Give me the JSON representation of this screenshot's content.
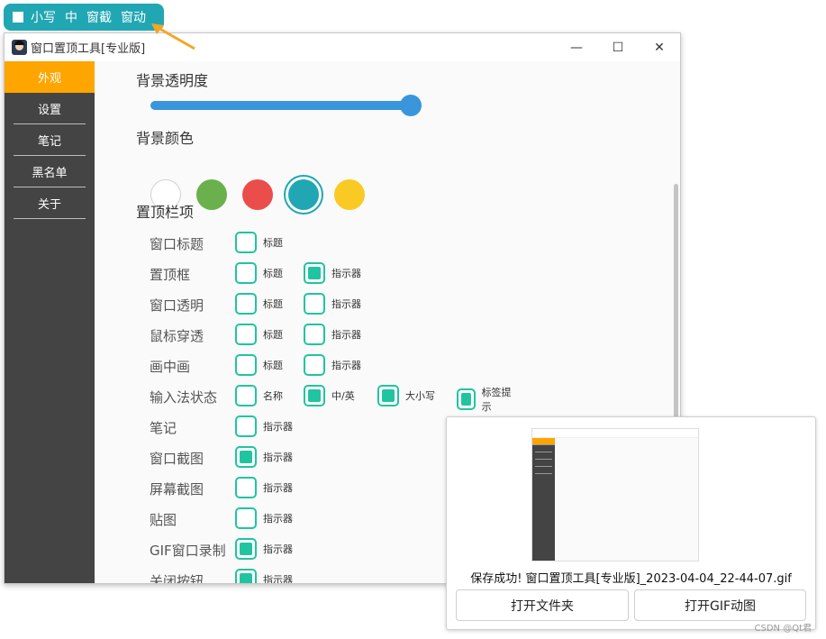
{
  "floatbar": {
    "items": [
      "小写",
      "中",
      "窗截",
      "窗动"
    ]
  },
  "window": {
    "title": "窗口置顶工具[专业版]",
    "controls": {
      "minimize": "—",
      "maximize": "☐",
      "close": "✕"
    }
  },
  "sidebar": {
    "items": [
      {
        "label": "外观"
      },
      {
        "label": "设置"
      },
      {
        "label": "笔记"
      },
      {
        "label": "黑名单"
      },
      {
        "label": "关于"
      }
    ]
  },
  "main": {
    "opacity_label": "背景透明度",
    "opacity_value": 1.0,
    "color_label": "背景颜色",
    "colors": [
      "#ffffff",
      "#6ab04c",
      "#eb4d4b",
      "#21a7b3",
      "#f9ca24"
    ],
    "selected_color": "#21a7b3",
    "topbar_label": "置顶栏项",
    "rows": [
      {
        "label": "窗口标题",
        "options": [
          {
            "text": "标题",
            "checked": false
          }
        ]
      },
      {
        "label": "置顶框",
        "options": [
          {
            "text": "标题",
            "checked": false
          },
          {
            "text": "指示器",
            "checked": true
          }
        ]
      },
      {
        "label": "窗口透明",
        "options": [
          {
            "text": "标题",
            "checked": false
          },
          {
            "text": "指示器",
            "checked": false
          }
        ]
      },
      {
        "label": "鼠标穿透",
        "options": [
          {
            "text": "标题",
            "checked": false
          },
          {
            "text": "指示器",
            "checked": false
          }
        ]
      },
      {
        "label": "画中画",
        "options": [
          {
            "text": "标题",
            "checked": false
          },
          {
            "text": "指示器",
            "checked": false
          }
        ]
      },
      {
        "label": "输入法状态",
        "options": [
          {
            "text": "名称",
            "checked": false
          },
          {
            "text": "中/英",
            "checked": true
          },
          {
            "text": "大小写",
            "checked": true
          },
          {
            "text": "标签提示",
            "checked": true
          }
        ]
      },
      {
        "label": "笔记",
        "options": [
          {
            "text": "指示器",
            "checked": false
          }
        ]
      },
      {
        "label": "窗口截图",
        "options": [
          {
            "text": "指示器",
            "checked": true
          }
        ]
      },
      {
        "label": "屏幕截图",
        "options": [
          {
            "text": "指示器",
            "checked": false
          }
        ]
      },
      {
        "label": "贴图",
        "options": [
          {
            "text": "指示器",
            "checked": false
          }
        ]
      },
      {
        "label": "GIF窗口录制",
        "options": [
          {
            "text": "指示器",
            "checked": true
          }
        ]
      },
      {
        "label": "关闭按钮",
        "options": [
          {
            "text": "指示器",
            "checked": true
          }
        ]
      }
    ]
  },
  "popup": {
    "message": "保存成功! 窗口置顶工具[专业版]_2023-04-04_22-44-07.gif",
    "open_folder": "打开文件夹",
    "open_gif": "打开GIF动图"
  },
  "watermark": "CSDN @Qt君"
}
